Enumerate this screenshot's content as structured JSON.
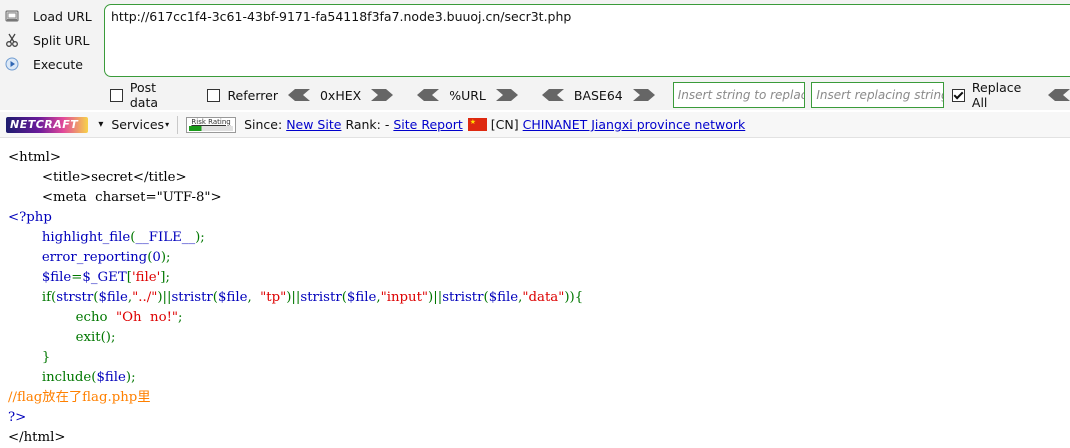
{
  "hackbar": {
    "load_url": "Load URL",
    "split_url": "Split URL",
    "execute": "Execute",
    "url": "http://617cc1f4-3c61-43bf-9171-fa54118f3fa7.node3.buuoj.cn/secr3t.php",
    "post_data": "Post data",
    "referrer": "Referrer",
    "hex": "0xHEX",
    "urlenc": "%URL",
    "base64": "BASE64",
    "replace_placeholder": "Insert string to replace",
    "replacing_placeholder": "Insert replacing string",
    "replace_all": "Replace All",
    "replace_all_checked": true,
    "accent_color": "#3a9b3a"
  },
  "netcraft": {
    "logo": "NETCRAFT",
    "services": "Services",
    "risk_rating": "Risk Rating",
    "since_label": "Since:",
    "since_value": "New Site",
    "rank_label": "Rank: -",
    "site_report": "Site Report",
    "country": "[CN]",
    "network": "CHINANET Jiangxi province network"
  },
  "source": {
    "l1": "<html>",
    "l2": "        <title>secret</title>",
    "l3": "        <meta  charset=\"UTF-8\">",
    "l4": "<?php",
    "l5_a": "        highlight_file",
    "l5_b": "(",
    "l5_c": "__FILE__",
    "l5_d": ");",
    "l6_a": "        error_reporting",
    "l6_b": "(",
    "l6_c": "0",
    "l6_d": ");",
    "l7_a": "        $file",
    "l7_b": "=",
    "l7_c": "$_GET",
    "l7_d": "[",
    "l7_e": "'file'",
    "l7_f": "];",
    "l8_a": "        if(",
    "l8_b": "strstr",
    "l8_c": "(",
    "l8_d": "$file",
    "l8_e": ",",
    "l8_f": "\"../\"",
    "l8_g": ")||",
    "l8_h": "stristr",
    "l8_i": "(",
    "l8_j": "$file",
    "l8_k": ",  ",
    "l8_l": "\"tp\"",
    "l8_m": ")||",
    "l8_n": "stristr",
    "l8_o": "(",
    "l8_p": "$file",
    "l8_q": ",",
    "l8_r": "\"input\"",
    "l8_s": ")||",
    "l8_t": "stristr",
    "l8_u": "(",
    "l8_v": "$file",
    "l8_w": ",",
    "l8_x": "\"data\"",
    "l8_y": ")){",
    "l9_a": "                echo  ",
    "l9_b": "\"Oh  no!\"",
    "l9_c": ";",
    "l10_a": "                exit",
    "l10_b": "();",
    "l11": "        }",
    "l12_a": "        include(",
    "l12_b": "$file",
    "l12_c": ");",
    "l13": "//flag放在了flag.php里",
    "l14": "?>",
    "l15": "</html>"
  }
}
